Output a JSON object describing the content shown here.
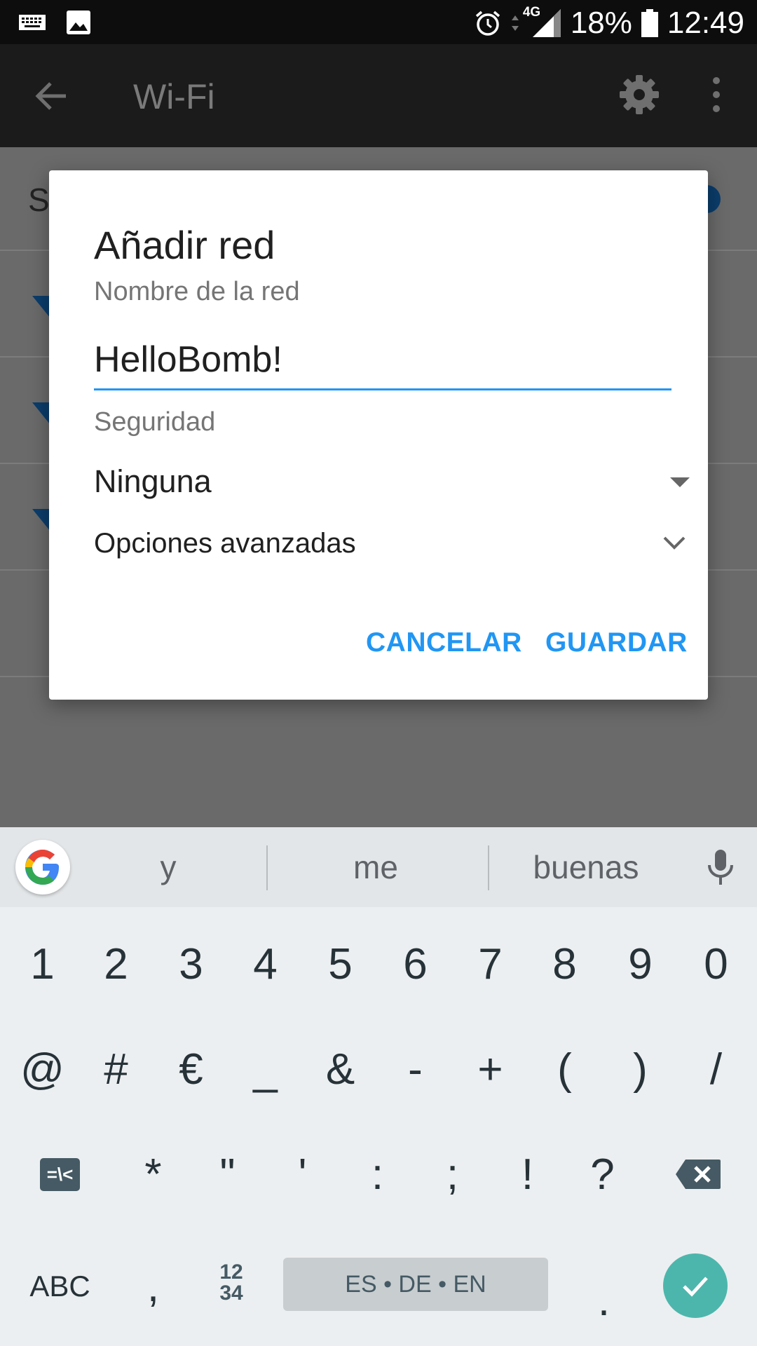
{
  "status_bar": {
    "battery": "18%",
    "time": "12:49",
    "network": "4G",
    "icons": [
      "keyboard-icon",
      "image-icon",
      "alarm-icon",
      "data-arrows-icon",
      "signal-icon",
      "battery-icon"
    ]
  },
  "toolbar": {
    "title": "Wi-Fi",
    "icons": [
      "back-arrow-icon",
      "gear-icon",
      "more-vert-icon"
    ]
  },
  "background": {
    "first_row_letter": "S"
  },
  "dialog": {
    "title": "Añadir red",
    "network_name_label": "Nombre de la red",
    "network_name_value": "HelloBomb!",
    "security_label": "Seguridad",
    "security_value": "Ninguna",
    "advanced_options": "Opciones avanzadas",
    "cancel_label": "CANCELAR",
    "save_label": "GUARDAR",
    "accent_color": "#2196f3"
  },
  "keyboard": {
    "suggestions": [
      "y",
      "me",
      "buenas"
    ],
    "row1": [
      "1",
      "2",
      "3",
      "4",
      "5",
      "6",
      "7",
      "8",
      "9",
      "0"
    ],
    "row2": [
      "@",
      "#",
      "€",
      "_",
      "&",
      "-",
      "+",
      "(",
      ")",
      "/"
    ],
    "row3": [
      "*",
      "\"",
      "'",
      ":",
      ";",
      "!",
      "?"
    ],
    "symbols_toggle": "=\\<",
    "abc_label": "ABC",
    "comma": ",",
    "num_toggle_top": "12",
    "num_toggle_bottom": "34",
    "space_label": "ES • DE • EN",
    "period": ".",
    "enter_color": "#4db6ac"
  }
}
